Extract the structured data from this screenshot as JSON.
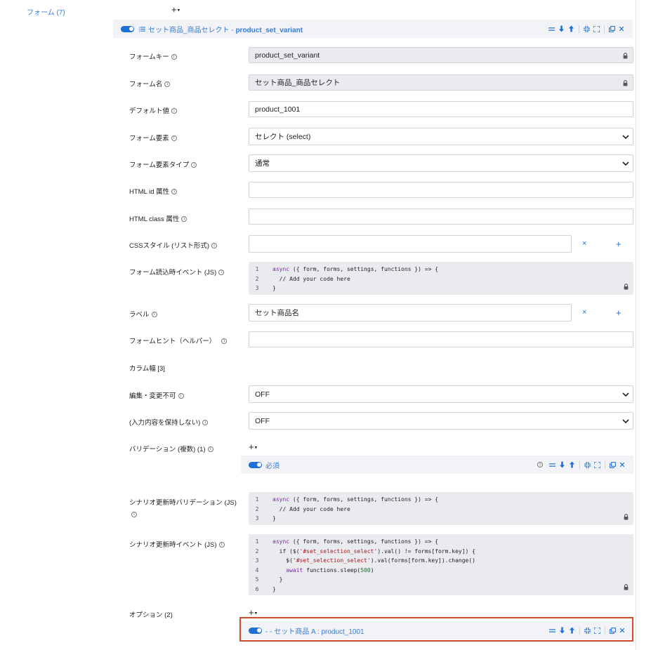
{
  "forms_section": {
    "label": "フォーム (7)"
  },
  "add_menu": {
    "plus": "+",
    "caret": "▾"
  },
  "form_panel": {
    "title_prefix": "セット商品_商品セレクト - ",
    "title_key": "product_set_variant"
  },
  "fields": {
    "form_key": {
      "label": "フォームキー",
      "value": "product_set_variant"
    },
    "form_name": {
      "label": "フォーム名",
      "value": "セット商品_商品セレクト"
    },
    "default_value": {
      "label": "デフォルト値",
      "value": "product_1001"
    },
    "form_element": {
      "label": "フォーム要素",
      "value": "セレクト (select)"
    },
    "form_element_type": {
      "label": "フォーム要素タイプ",
      "value": "通常"
    },
    "html_id": {
      "label": "HTML id 属性",
      "value": ""
    },
    "html_class": {
      "label": "HTML class 属性",
      "value": ""
    },
    "css_style": {
      "label": "CSSスタイル (リスト形式)",
      "value": ""
    },
    "on_load_event": {
      "label": "フォーム読込時イベント (JS)"
    },
    "label": {
      "label": "ラベル",
      "value": "セット商品名"
    },
    "form_hint": {
      "label": "フォームヒント（ヘルパー）",
      "value": ""
    },
    "column_width": {
      "label": "カラム幅 [3]"
    },
    "non_editable": {
      "label": "編集・変更不可",
      "value": "OFF"
    },
    "no_retain": {
      "label": "(入力内容を保持しない)",
      "value": "OFF"
    },
    "validation": {
      "label": "バリデーション (複数) (1)"
    },
    "scenario_validation": {
      "label": "シナリオ更新時バリデーション (JS)"
    },
    "scenario_event": {
      "label": "シナリオ更新時イベント (JS)"
    },
    "options": {
      "label": "オプション (2)"
    }
  },
  "code_onload": {
    "lines": [
      "1",
      "2",
      "3"
    ],
    "l1_kw": "async",
    "l1_rest": " ({ form, forms, settings, functions }) => {",
    "l2": "  // Add your code here",
    "l3": "}"
  },
  "code_validation": {
    "lines": [
      "1",
      "2",
      "3"
    ],
    "l1_kw": "async",
    "l1_rest": " ({ form, forms, settings, functions }) => {",
    "l2": "  // Add your code here",
    "l3": "}"
  },
  "code_scenario": {
    "lines": [
      "1",
      "2",
      "3",
      "4",
      "5",
      "6"
    ],
    "l1_kw": "async",
    "l1_rest": " ({ form, forms, settings, functions }) => {",
    "l2_a": "  if ($(",
    "l2_str": "'#set_selection_select'",
    "l2_b": ").val() != forms[form.key]) {",
    "l3_a": "    $(",
    "l3_str": "'#set_selection_select'",
    "l3_b": ").val(forms[form.key]).change()",
    "l4_kw": "    await",
    "l4_a": " functions.sleep(",
    "l4_num": "500",
    "l4_b": ")",
    "l5": "  }",
    "l6": "}"
  },
  "validation_item": {
    "label": "必須"
  },
  "option_item": {
    "label": "- - セット商品 A : product_1001"
  },
  "buttons": {
    "clear": "×",
    "add": "+"
  },
  "icons": {
    "toggle": "toggle-icon",
    "list": "list-icon",
    "drag": "drag-handle-icon",
    "move_down": "arrow-down-icon",
    "move_up": "arrow-up-icon",
    "collapse": "collapse-icon",
    "expand": "expand-icon",
    "copy": "copy-icon",
    "close": "close-icon",
    "lock": "lock-icon",
    "info": "info-icon",
    "chevron": "chevron-down-icon"
  },
  "colors": {
    "accent": "#1f6fd6",
    "link": "#3a7bd5",
    "highlight": "#d24a2e",
    "panel": "#f1f3f6",
    "locked": "#e9ebee"
  }
}
